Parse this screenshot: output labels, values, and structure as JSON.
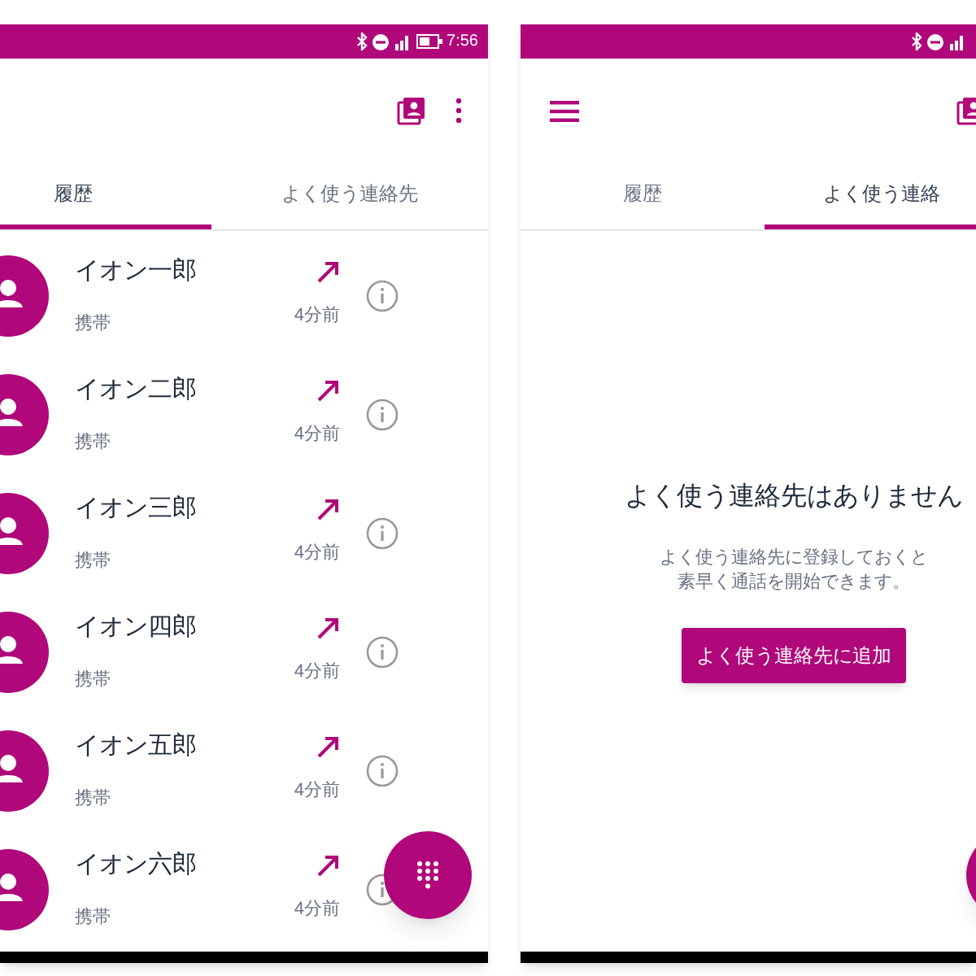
{
  "screens": [
    {
      "status_bar": {
        "time": "7:56"
      },
      "tabs": [
        {
          "label": "履歴",
          "selected": true
        },
        {
          "label": "よく使う連絡先",
          "selected": false
        }
      ],
      "calls": [
        {
          "name": "イオン一郎",
          "type": "携帯",
          "time": "4分前"
        },
        {
          "name": "イオン二郎",
          "type": "携帯",
          "time": "4分前"
        },
        {
          "name": "イオン三郎",
          "type": "携帯",
          "time": "4分前"
        },
        {
          "name": "イオン四郎",
          "type": "携帯",
          "time": "4分前"
        },
        {
          "name": "イオン五郎",
          "type": "携帯",
          "time": "4分前"
        },
        {
          "name": "イオン六郎",
          "type": "携帯",
          "time": "4分前"
        }
      ]
    },
    {
      "tabs": [
        {
          "label": "履歴",
          "selected": false
        },
        {
          "label": "よく使う連絡",
          "selected": true
        }
      ],
      "empty_state": {
        "title": "よく使う連絡先はありません",
        "message_lines": [
          "よく使う連絡先に登録しておくと",
          "素早く通話を開始できます。"
        ],
        "button": "よく使う連絡先に追加"
      }
    }
  ]
}
